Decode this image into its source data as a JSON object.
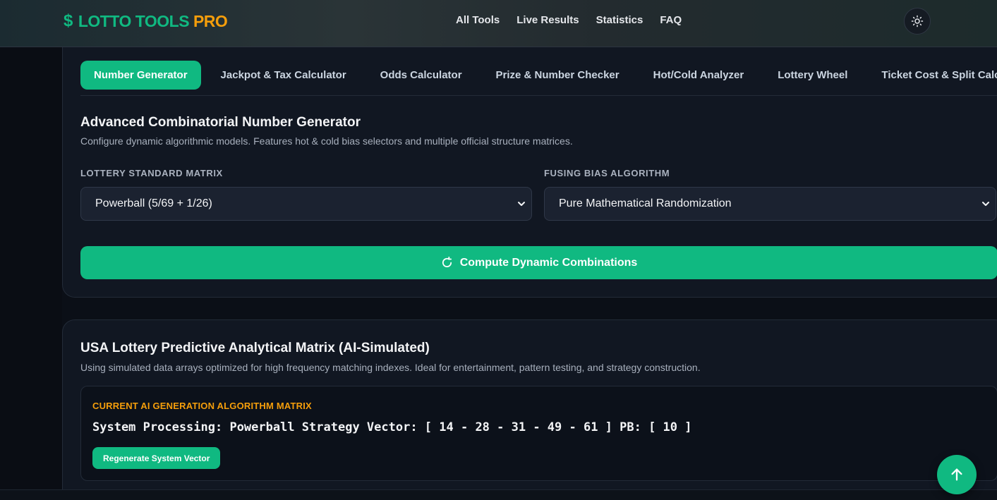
{
  "brand": {
    "dollar": "$",
    "name": "LOTTO TOOLS",
    "suffix": "PRO",
    "accent": "#10b981",
    "suffix_color": "#f59e0b"
  },
  "nav": {
    "items": [
      "All Tools",
      "Live Results",
      "Statistics",
      "FAQ"
    ]
  },
  "theme_toggle_icon": "sun-icon",
  "tabs": [
    {
      "label": "Number Generator",
      "active": true
    },
    {
      "label": "Jackpot & Tax Calculator",
      "active": false
    },
    {
      "label": "Odds Calculator",
      "active": false
    },
    {
      "label": "Prize & Number Checker",
      "active": false
    },
    {
      "label": "Hot/Cold Analyzer",
      "active": false
    },
    {
      "label": "Lottery Wheel",
      "active": false
    },
    {
      "label": "Ticket Cost & Split Calc",
      "active": false
    }
  ],
  "generator": {
    "title": "Advanced Combinatorial Number Generator",
    "description": "Configure dynamic algorithmic models. Features hot & cold bias selectors and multiple official structure matrices.",
    "matrix_label": "LOTTERY STANDARD MATRIX",
    "matrix_value": "Powerball (5/69 + 1/26)",
    "bias_label": "FUSING BIAS ALGORITHM",
    "bias_value": "Pure Mathematical Randomization",
    "compute_label": "Compute Dynamic Combinations"
  },
  "predictive": {
    "title": "USA Lottery Predictive Analytical Matrix (AI-Simulated)",
    "description": "Using simulated data arrays optimized for high frequency matching indexes. Ideal for entertainment, pattern testing, and strategy construction.",
    "matrix_label": "CURRENT AI GENERATION ALGORITHM MATRIX",
    "vector_text": "System Processing: Powerball Strategy Vector: [ 14 - 28 - 31 - 49 - 61 ] PB: [ 10 ]",
    "regenerate_label": "Regenerate System Vector"
  },
  "scroll_top_icon": "arrow-up-icon"
}
